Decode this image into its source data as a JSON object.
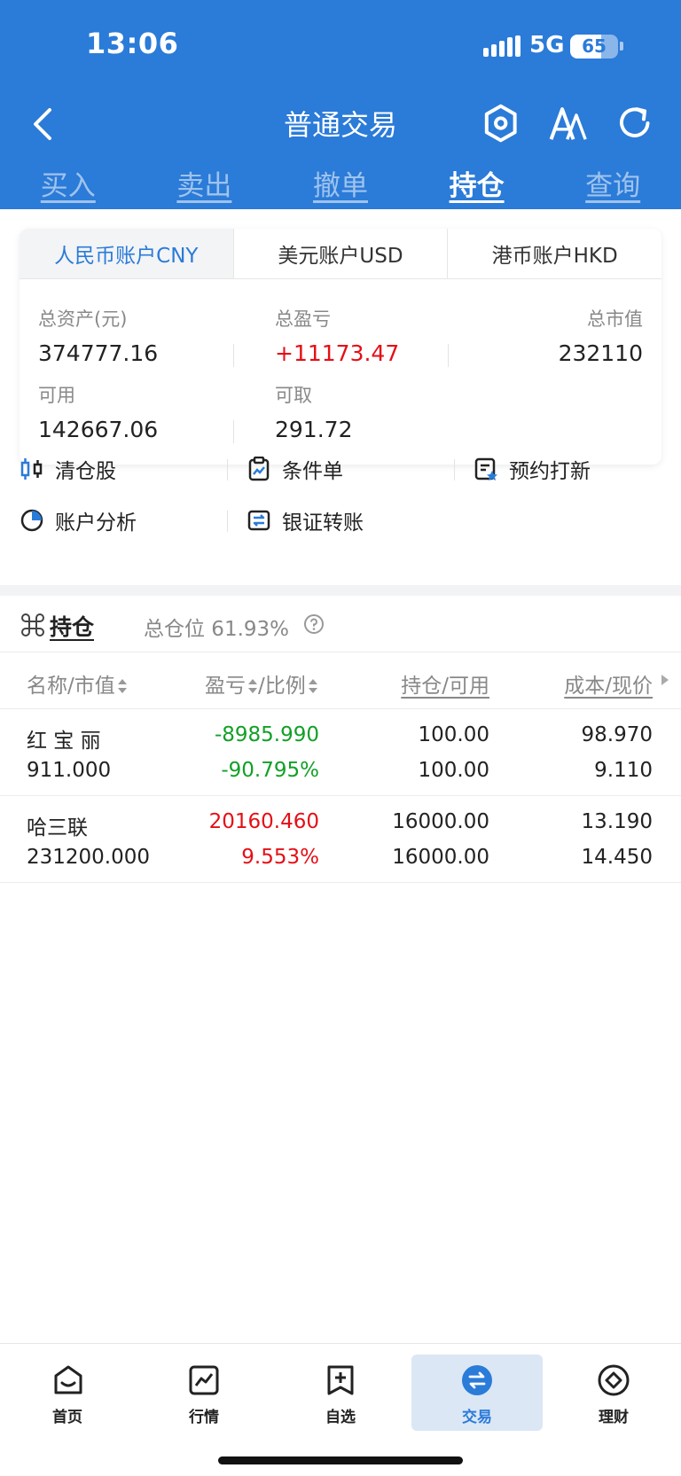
{
  "status": {
    "time": "13:06",
    "network": "5G",
    "battery": "65",
    "battery_level": 0.65
  },
  "header": {
    "title": "普通交易"
  },
  "tabs": [
    {
      "label": "买入"
    },
    {
      "label": "卖出"
    },
    {
      "label": "撤单"
    },
    {
      "label": "持仓",
      "active": true
    },
    {
      "label": "查询"
    }
  ],
  "account_tabs": [
    {
      "label": "人民币账户CNY",
      "active": true
    },
    {
      "label": "美元账户USD"
    },
    {
      "label": "港币账户HKD"
    }
  ],
  "summary": {
    "total_assets_label": "总资产(元)",
    "total_assets": "374777.16",
    "total_pl_label": "总盈亏",
    "total_pl": "+11173.47",
    "market_value_label": "总市值",
    "market_value": "232110",
    "available_label": "可用",
    "available": "142667.06",
    "withdrawable_label": "可取",
    "withdrawable": "291.72"
  },
  "tools": [
    {
      "label": "清仓股",
      "icon": "candlestick-icon"
    },
    {
      "label": "条件单",
      "icon": "clipboard-chart-icon"
    },
    {
      "label": "预约打新",
      "icon": "document-star-icon"
    },
    {
      "label": "账户分析",
      "icon": "pie-chart-icon"
    },
    {
      "label": "银证转账",
      "icon": "transfer-icon"
    }
  ],
  "holdings": {
    "title": "持仓",
    "total_position": "总仓位 61.93%",
    "columns": {
      "name": "名称/市值",
      "pl": "盈亏",
      "ratio": "/比例",
      "qty": "持仓/可用",
      "cost": "成本/现价"
    },
    "rows": [
      {
        "name": "红 宝 丽",
        "market_value": "911.000",
        "pl": "-8985.990",
        "ratio": "-90.795%",
        "position": "100.00",
        "available": "100.00",
        "cost": "98.970",
        "price": "9.110",
        "trend": "down"
      },
      {
        "name": "哈三联",
        "market_value": "231200.000",
        "pl": "20160.460",
        "ratio": "9.553%",
        "position": "16000.00",
        "available": "16000.00",
        "cost": "13.190",
        "price": "14.450",
        "trend": "up"
      }
    ]
  },
  "bottom_nav": [
    {
      "label": "首页",
      "icon": "home-icon"
    },
    {
      "label": "行情",
      "icon": "market-chart-icon"
    },
    {
      "label": "自选",
      "icon": "watchlist-add-icon"
    },
    {
      "label": "交易",
      "icon": "trade-exchange-icon",
      "active": true
    },
    {
      "label": "理财",
      "icon": "wealth-icon"
    }
  ],
  "colors": {
    "brand": "#2b7bd8",
    "up": "#e60e16",
    "down": "#12a027"
  }
}
